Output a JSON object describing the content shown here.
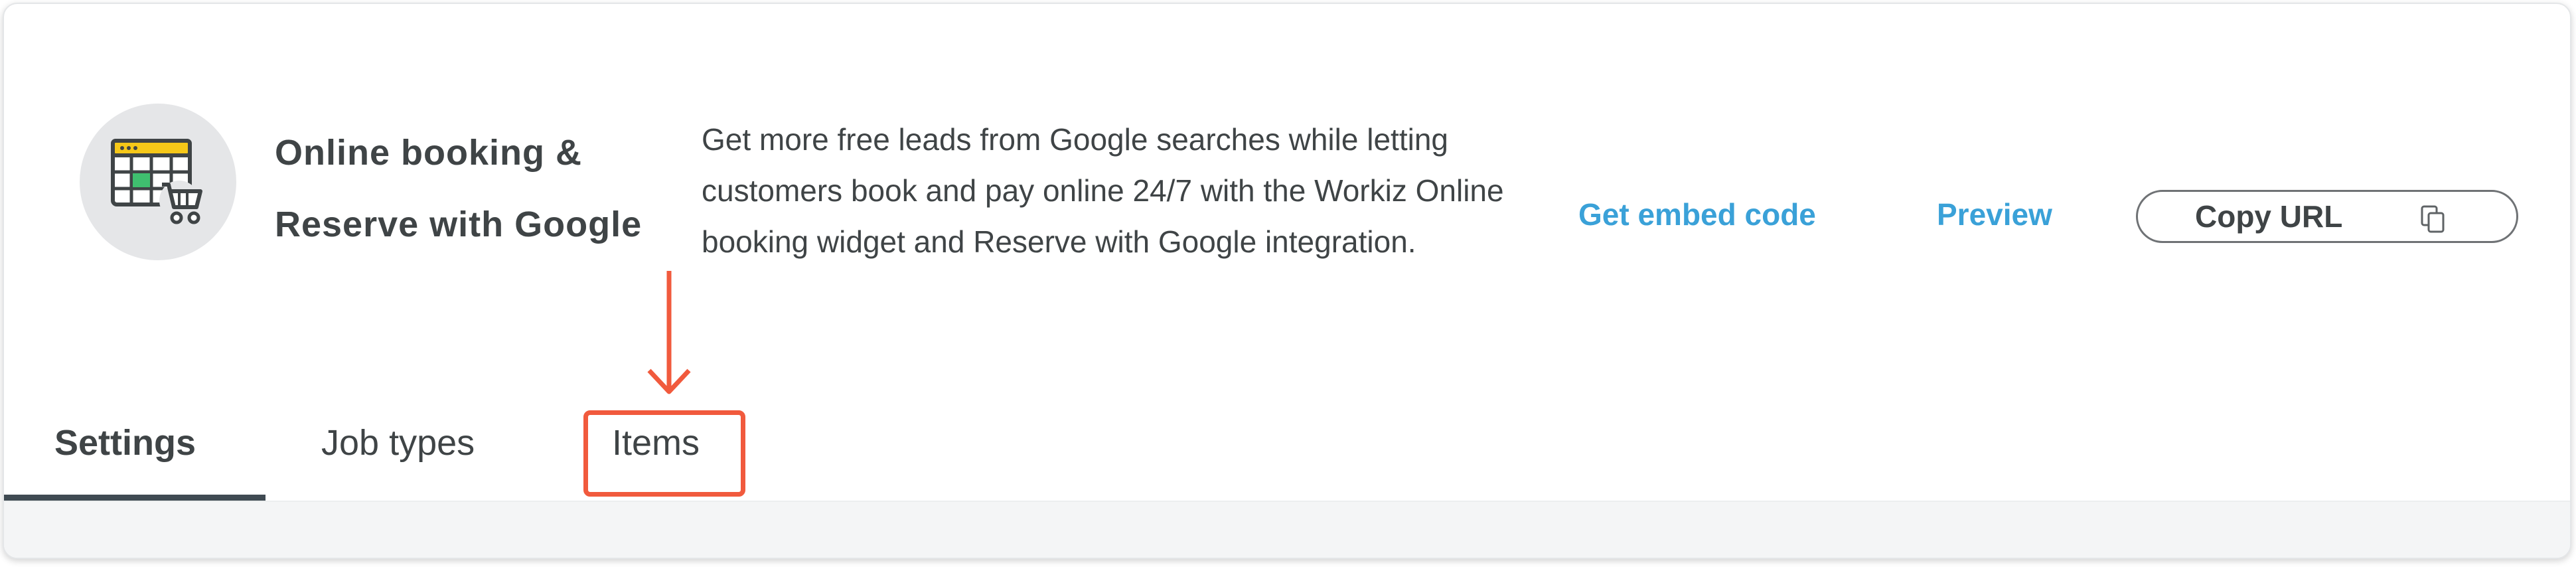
{
  "header": {
    "title_line1": "Online booking &",
    "title_line2": "Reserve with Google",
    "description": "Get more free leads from Google searches while letting customers book and pay online 24/7 with the Workiz Online booking widget and Reserve with Google integration.",
    "logo_icon": "calendar-cart-icon"
  },
  "actions": {
    "embed_label": "Get embed code",
    "preview_label": "Preview",
    "copy_url_label": "Copy URL",
    "copy_icon": "copy-icon"
  },
  "tabs": [
    {
      "label": "Settings",
      "active": true
    },
    {
      "label": "Job types",
      "active": false
    },
    {
      "label": "Items",
      "active": false
    }
  ],
  "colors": {
    "link": "#3aa1d8",
    "highlight": "#f15a3d",
    "active_underline": "#3f4a52",
    "logo_yellow": "#f6c818",
    "logo_green": "#3fbf6f"
  }
}
